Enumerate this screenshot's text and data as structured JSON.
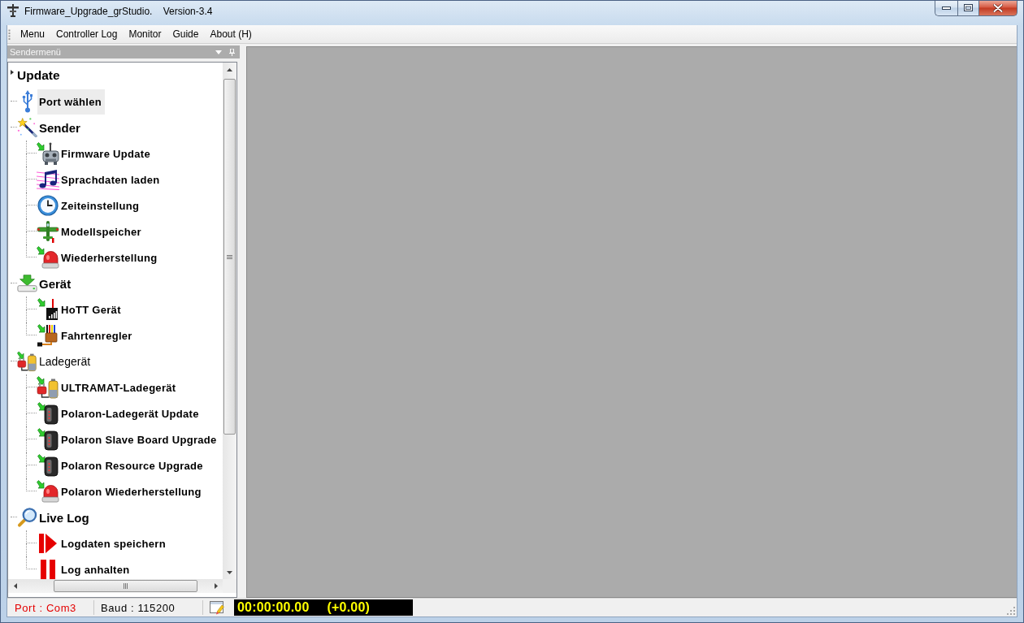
{
  "window": {
    "title": "Firmware_Upgrade_grStudio.    Version-3.4"
  },
  "menu": [
    "Menu",
    "Controller Log",
    "Monitor",
    "Guide",
    "About (H)"
  ],
  "panel": {
    "title": "Sendermenü"
  },
  "tree": [
    {
      "label": "Update",
      "kind": "header",
      "selected": false
    },
    {
      "label": "Port wählen",
      "kind": "entry",
      "selected": true
    },
    {
      "label": "Sender",
      "kind": "section",
      "selected": false,
      "children": [
        {
          "label": "Firmware Update",
          "kind": "entry",
          "selected": false
        },
        {
          "label": "Sprachdaten laden",
          "kind": "entry",
          "selected": false
        },
        {
          "label": "Zeiteinstellung",
          "kind": "entry",
          "selected": false
        },
        {
          "label": "Modellspeicher",
          "kind": "entry",
          "selected": false
        },
        {
          "label": "Wiederherstellung",
          "kind": "entry",
          "selected": false
        }
      ]
    },
    {
      "label": "Gerät",
      "kind": "section",
      "selected": false,
      "children": [
        {
          "label": "HoTT Gerät",
          "kind": "entry",
          "selected": false
        },
        {
          "label": "Fahrtenregler",
          "kind": "entry",
          "selected": false
        }
      ]
    },
    {
      "label": "Ladegerät",
      "kind": "plain",
      "selected": false,
      "children": [
        {
          "label": "ULTRAMAT-Ladegerät",
          "kind": "entry",
          "selected": false
        },
        {
          "label": "Polaron-Ladegerät Update",
          "kind": "entry",
          "selected": false
        },
        {
          "label": "Polaron Slave Board Upgrade",
          "kind": "entry",
          "selected": false
        },
        {
          "label": "Polaron Resource Upgrade",
          "kind": "entry",
          "selected": false
        },
        {
          "label": "Polaron Wiederherstellung",
          "kind": "entry",
          "selected": false
        }
      ]
    },
    {
      "label": "Live Log",
      "kind": "section",
      "selected": false,
      "children": [
        {
          "label": "Logdaten speichern",
          "kind": "entry",
          "selected": false
        },
        {
          "label": "Log anhalten",
          "kind": "entry",
          "selected": false
        }
      ]
    }
  ],
  "status_bar": {
    "port": "Port : Com3",
    "baud": "Baud : 115200",
    "elapsed": "00:00:00.00",
    "offset": "(+0.00)"
  }
}
